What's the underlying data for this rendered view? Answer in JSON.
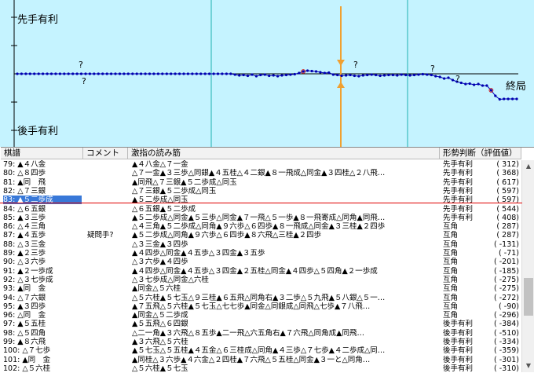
{
  "graph": {
    "top_label": "先手有利",
    "bottom_label": "後手有利",
    "end_label": "終局",
    "question_mark": "?",
    "colors": {
      "background": "#c5f3ff",
      "line": "#0000b0",
      "marker": "#ff9900",
      "cursor": "#f0a030",
      "divider": "#20b0b0",
      "highlight": "#d02020"
    },
    "series_values": [
      0,
      0,
      0,
      0,
      0,
      0,
      0,
      0,
      0,
      0,
      0,
      0,
      0,
      0,
      0,
      0,
      0,
      0,
      0,
      0,
      0,
      0,
      0,
      0,
      0,
      0,
      0,
      0,
      0,
      0,
      0,
      0,
      0,
      0,
      0,
      0,
      0,
      0,
      0,
      0,
      0,
      0,
      0,
      0,
      0,
      0,
      0,
      0,
      0,
      0,
      0,
      -20,
      -40,
      -30,
      -50,
      -20,
      -60,
      -30,
      -20,
      -50,
      -40,
      -60,
      -40,
      -30,
      -20,
      -10,
      20,
      60,
      80,
      70,
      60,
      40,
      20,
      30,
      -20,
      -30,
      -50,
      -40,
      -30,
      -50,
      -60,
      -40,
      -30,
      -20,
      -30,
      -50,
      -40,
      -30,
      -30,
      -40,
      -20,
      -30,
      -40,
      -30,
      -20,
      -10,
      -20,
      -30,
      -60,
      -80,
      -120,
      -100,
      -160,
      -200,
      -230,
      -260,
      -250,
      -280,
      -260,
      -300,
      -300,
      -420,
      -560,
      -650,
      -640,
      -640,
      -640,
      -640
    ]
  },
  "headers": {
    "kifu": "棋譜",
    "comment": "コメント",
    "pv": "激指の読み筋",
    "eval": "形勢判断（評価値）"
  },
  "rows": [
    {
      "move": "79: ▲４八金",
      "comment": "",
      "pv": "▲４八金△７一金",
      "eval": "先手有利",
      "score": "(   312)"
    },
    {
      "move": "80: △８四歩",
      "comment": "",
      "pv": "△７一金▲３三歩△同銀▲４五桂△４二銀▲８一飛成△同金▲３四桂△２八飛…",
      "eval": "先手有利",
      "score": "(   368)"
    },
    {
      "move": "81: ▲同　飛",
      "comment": "",
      "pv": "▲同飛△７三銀▲５二歩成△同玉",
      "eval": "先手有利",
      "score": "(   617)"
    },
    {
      "move": "82: △７三銀",
      "comment": "",
      "pv": "△７三銀▲５二歩成△同玉",
      "eval": "先手有利",
      "score": "(   597)"
    },
    {
      "move": "83: ▲５二歩成",
      "comment": "",
      "pv": "▲５二歩成△同玉",
      "eval": "先手有利",
      "score": "(   597)"
    },
    {
      "move": "84: △６五銀",
      "comment": "",
      "pv": "△６五銀▲５二歩成",
      "eval": "先手有利",
      "score": "(   544)"
    },
    {
      "move": "85: ▲３三歩",
      "comment": "",
      "pv": "▲５二歩成△同金▲５三歩△同金▲７一飛△５一歩▲８一飛寄成△同角▲同飛…",
      "eval": "先手有利",
      "score": "(   408)"
    },
    {
      "move": "86: △４三角",
      "comment": "",
      "pv": "△４三角▲５二歩成△同角▲９六歩△６四歩▲８一飛成△同金▲３三桂▲２四歩",
      "eval": "互角",
      "score": "(   287)"
    },
    {
      "move": "87: ▲４五歩",
      "comment": "疑問手?",
      "pv": "▲５二歩成△同角▲９六歩△６四歩▲８六飛△三桂▲２四歩",
      "eval": "互角",
      "score": "(   287)"
    },
    {
      "move": "88: △３三金",
      "comment": "",
      "pv": "△３三金▲３四歩",
      "eval": "互角",
      "score": "(  -131)"
    },
    {
      "move": "89: ▲２三歩",
      "comment": "",
      "pv": "▲４四歩△同金▲４五歩△３四金▲３五歩",
      "eval": "互角",
      "score": "(   -71)"
    },
    {
      "move": "90: △３六歩",
      "comment": "",
      "pv": "△３六歩▲４四歩",
      "eval": "互角",
      "score": "(  -201)"
    },
    {
      "move": "91: ▲２一歩成",
      "comment": "",
      "pv": "▲４四歩△同金▲４五歩△３四金▲２五桂△同金▲４四歩△５四角▲２一歩成",
      "eval": "互角",
      "score": "(  -185)"
    },
    {
      "move": "92: △３七歩成",
      "comment": "",
      "pv": "△３七歩成△同金△六桂",
      "eval": "互角",
      "score": "(  -275)"
    },
    {
      "move": "93: ▲同　金",
      "comment": "",
      "pv": "▲同金△５六桂",
      "eval": "互角",
      "score": "(  -275)"
    },
    {
      "move": "94: △７六銀",
      "comment": "",
      "pv": "△５六桂▲５七玉△９三桂▲６五飛△同角右▲３二歩△５九飛▲５八銀△５一…",
      "eval": "互角",
      "score": "(  -272)"
    },
    {
      "move": "95: ▲３四歩",
      "comment": "",
      "pv": "▲７五飛△５六桂▲５七玉△七七歩▲同金△同銀成△同飛△七歩▲７八飛…",
      "eval": "互角",
      "score": "(   -90)"
    },
    {
      "move": "96: △同　金",
      "comment": "",
      "pv": "▲同金△５二歩成",
      "eval": "互角",
      "score": "(  -296)"
    },
    {
      "move": "97: ▲５五桂",
      "comment": "",
      "pv": "▲５五飛△６四銀",
      "eval": "後手有利",
      "score": "(  -384)"
    },
    {
      "move": "98: △５四角",
      "comment": "",
      "pv": "△二一角▲３六飛△８五歩▲二一飛△六五角右▲７六飛△同角成▲同飛…",
      "eval": "後手有利",
      "score": "(  -510)"
    },
    {
      "move": "99: ▲８六飛",
      "comment": "",
      "pv": "▲３六飛△５六桂",
      "eval": "後手有利",
      "score": "(  -334)"
    },
    {
      "move": "100: △７七歩",
      "comment": "",
      "pv": "▲５七玉△５五桂▲４五金△６三桂成△同角▲４三歩△７七歩▲４二歩成△同…",
      "eval": "後手有利",
      "score": "(  -359)"
    },
    {
      "move": "101: ▲同　金",
      "comment": "",
      "pv": "▲同桂△３六歩▲４六金△２四桂▲７六飛△５五桂△同金▲３一と△同角…",
      "eval": "後手有利",
      "score": "(  -301)"
    },
    {
      "move": "102: △５六桂",
      "comment": "",
      "pv": "△５六桂▲５七玉",
      "eval": "後手有利",
      "score": "(  -310)"
    }
  ]
}
